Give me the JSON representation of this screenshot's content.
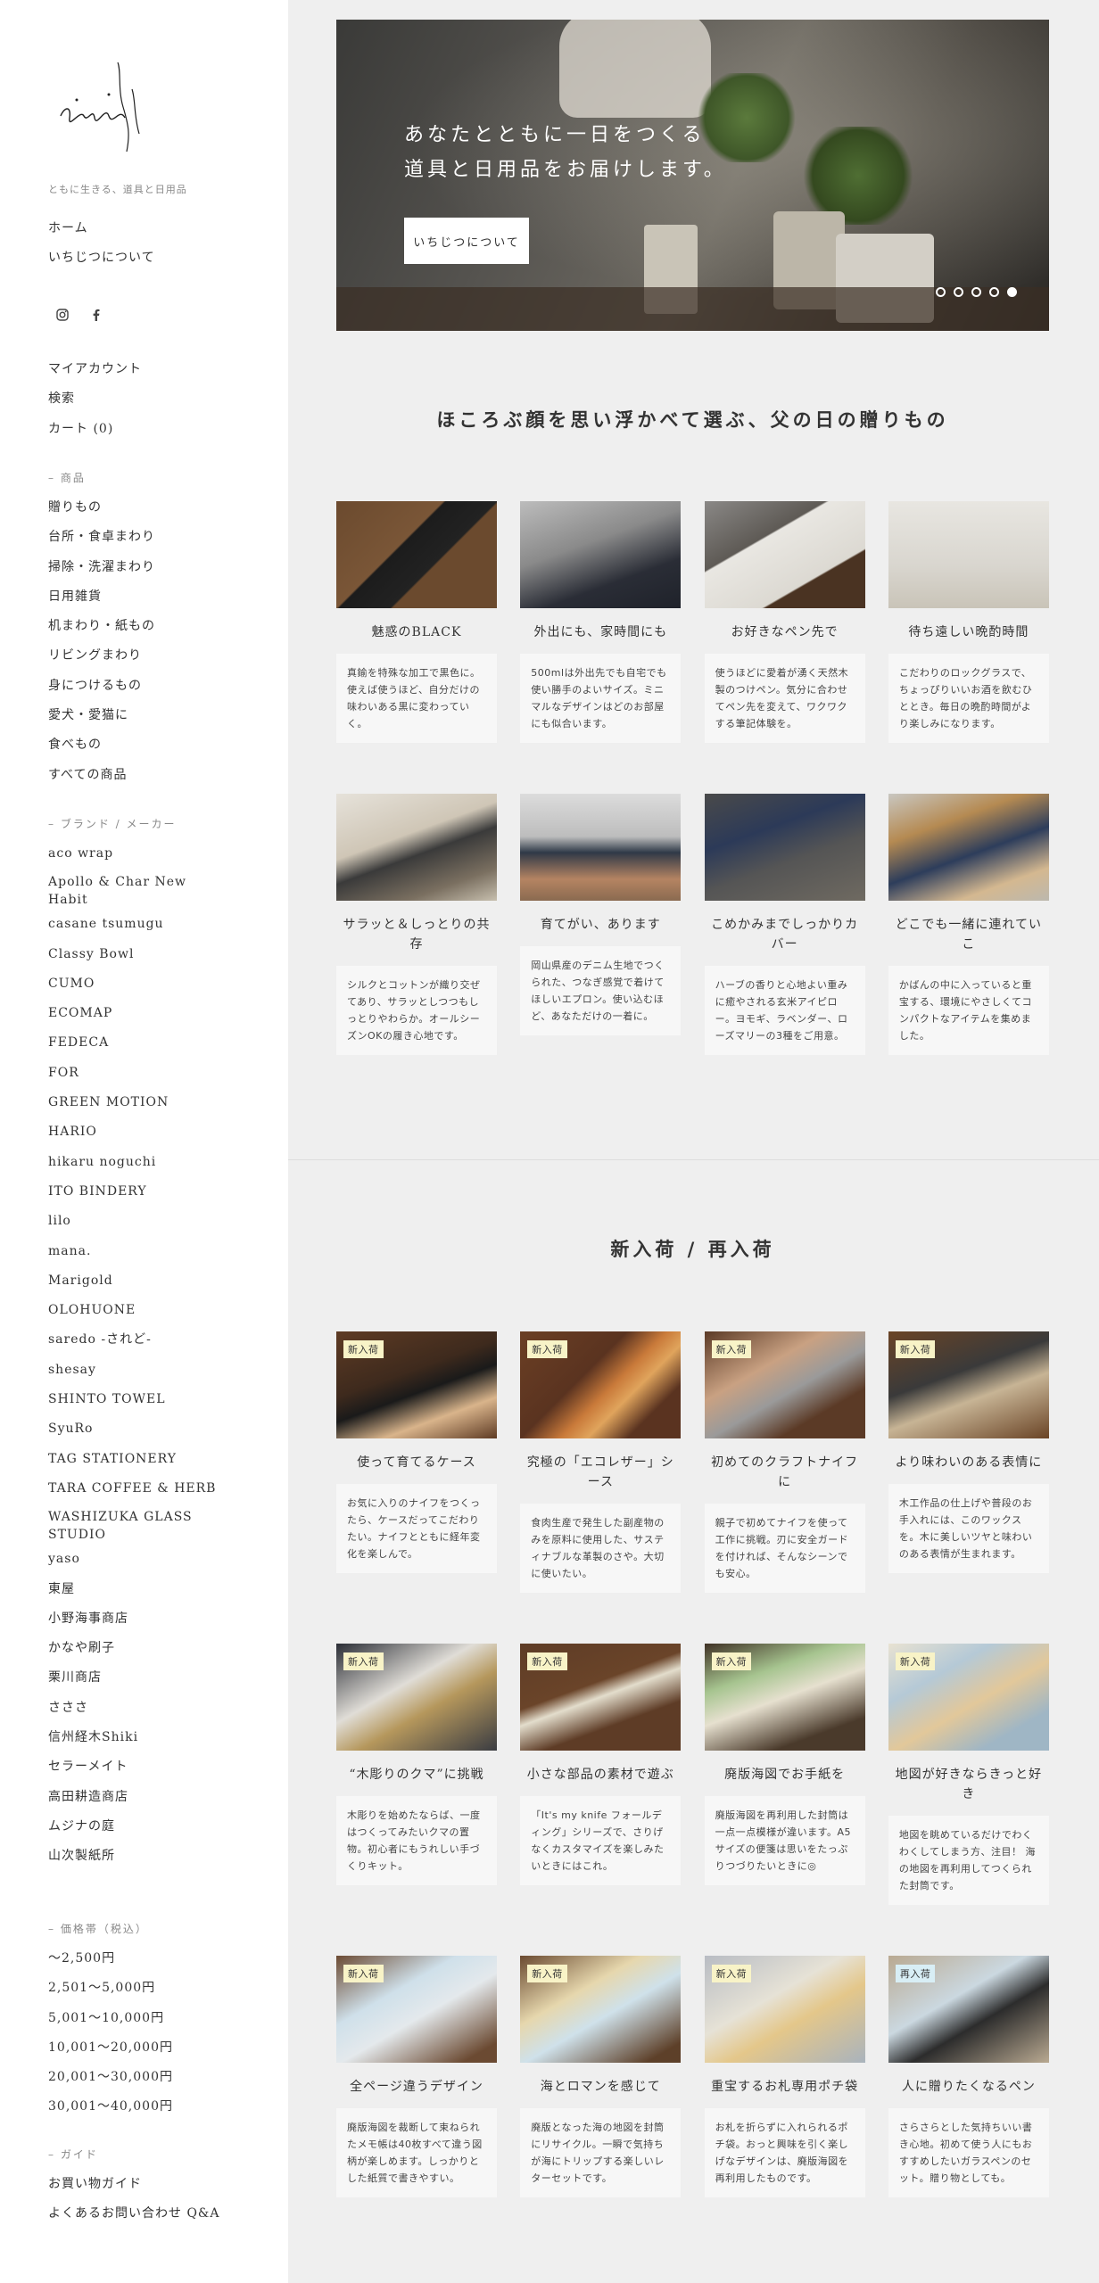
{
  "sidebar": {
    "tagline": "ともに生きる、道具と日用品",
    "primary_nav": [
      "ホーム",
      "いちじつについて"
    ],
    "account_nav": [
      "マイアカウント",
      "検索",
      "カート (0)"
    ],
    "products_head": "– 商品",
    "products": [
      "贈りもの",
      "台所・食卓まわり",
      "掃除・洗濯まわり",
      "日用雑貨",
      "机まわり・紙もの",
      "リビングまわり",
      "身につけるもの",
      "愛犬・愛猫に",
      "食べもの",
      "すべての商品"
    ],
    "brands_head": "– ブランド / メーカー",
    "brands": [
      "aco wrap",
      "Apollo & Char New Habit",
      "casane tsumugu",
      "Classy Bowl",
      "CUMO",
      "ECOMAP",
      "FEDECA",
      "FOR",
      "GREEN MOTION",
      "HARIO",
      "hikaru noguchi",
      "ITO BINDERY",
      "lilo",
      "mana.",
      "Marigold",
      "OLOHUONE",
      "saredo -されど-",
      "shesay",
      "SHINTO TOWEL",
      "SyuRo",
      "TAG STATIONERY",
      "TARA COFFEE & HERB",
      "WASHIZUKA GLASS STUDIO",
      "yaso",
      "東屋",
      "小野海事商店",
      "かなや刷子",
      "栗川商店",
      "さささ",
      "信州経木Shiki",
      "セラーメイト",
      "高田耕造商店",
      "ムジナの庭",
      "山次製紙所"
    ],
    "price_head": "– 価格帯（税込）",
    "prices": [
      "〜2,500円",
      "2,501〜5,000円",
      "5,001〜10,000円",
      "10,001〜20,000円",
      "20,001〜30,000円",
      "30,001〜40,000円"
    ],
    "guide_head": "– ガイド",
    "guide": [
      "お買い物ガイド",
      "よくあるお問い合わせ Q&A"
    ]
  },
  "hero": {
    "line1": "あなたとともに一日をつくる",
    "line2": "道具と日用品をお届けします。",
    "button": "いちじつについて",
    "slide_count": 5,
    "active_slide": 5
  },
  "section1": {
    "title": "ほころぶ顔を思い浮かべて選ぶ、父の日の贈りもの",
    "cards": [
      {
        "title": "魅惑のBLACK",
        "desc": "真鍮を特殊な加工で黒色に。使えば使うほど、自分だけの味わいある黒に変わっていく。"
      },
      {
        "title": "外出にも、家時間にも",
        "desc": "500mlは外出先でも自宅でも使い勝手のよいサイズ。ミニマルなデザインはどのお部屋にも似合います。"
      },
      {
        "title": "お好きなペン先で",
        "desc": "使うほどに愛着が湧く天然木製のつけペン。気分に合わせてペン先を変えて、ワクワクする筆記体験を。"
      },
      {
        "title": "待ち遠しい晩酌時間",
        "desc": "こだわりのロックグラスで、ちょっぴりいいお酒を飲むひととき。毎日の晩酌時間がより楽しみになります。"
      },
      {
        "title": "サラッと＆しっとりの共存",
        "desc": "シルクとコットンが織り交ぜてあり、サラッとしつつもしっとりやわらか。オールシーズンOKの履き心地です。"
      },
      {
        "title": "育てがい、あります",
        "desc": "岡山県産のデニム生地でつくられた、つなぎ感覚で着けてほしいエプロン。使い込むほど、あなただけの一着に。"
      },
      {
        "title": "こめかみまでしっかりカバー",
        "desc": "ハーブの香りと心地よい重みに癒やされる玄米アイピロー。ヨモギ、ラベンダー、ローズマリーの3種をご用意。"
      },
      {
        "title": "どこでも一緒に連れていこ",
        "desc": "かばんの中に入っていると重宝する、環境にやさしくてコンパクトなアイテムを集めました。"
      }
    ]
  },
  "section2": {
    "title": "新入荷 / 再入荷",
    "cards": [
      {
        "badge": "新入荷",
        "title": "使って育てるケース",
        "desc": "お気に入りのナイフをつくったら、ケースだってこだわりたい。ナイフとともに経年変化を楽しんで。"
      },
      {
        "badge": "新入荷",
        "title": "究極の「エコレザー」シース",
        "desc": "食肉生産で発生した副産物のみを原料に使用した、サスティナブルな革製のさや。大切に使いたい。"
      },
      {
        "badge": "新入荷",
        "title": "初めてのクラフトナイフに",
        "desc": "親子で初めてナイフを使って工作に挑戦。刃に安全ガードを付ければ、そんなシーンでも安心。"
      },
      {
        "badge": "新入荷",
        "title": "より味わいのある表情に",
        "desc": "木工作品の仕上げや普段のお手入れには、このワックスを。木に美しいツヤと味わいのある表情が生まれます。"
      },
      {
        "badge": "新入荷",
        "title": "“木彫りのクマ”に挑戦",
        "desc": "木彫りを始めたならば、一度はつくってみたいクマの置物。初心者にもうれしい手づくりキット。"
      },
      {
        "badge": "新入荷",
        "title": "小さな部品の素材で遊ぶ",
        "desc": "「It's my knife フォールディング」シリーズで、さりげなくカスタマイズを楽しみたいときにはこれ。"
      },
      {
        "badge": "新入荷",
        "title": "廃版海図でお手紙を",
        "desc": "廃版海図を再利用した封筒は一点一点模様が違います。A5サイズの便箋は思いをたっぷりつづりたいときに◎"
      },
      {
        "badge": "新入荷",
        "title": "地図が好きならきっと好き",
        "desc": "地図を眺めているだけでわくわくしてしまう方、注目！ 海の地図を再利用してつくられた封筒です。"
      },
      {
        "badge": "新入荷",
        "title": "全ページ違うデザイン",
        "desc": "廃版海図を裁断して束ねられたメモ帳は40枚すべて違う図柄が楽しめます。しっかりとした紙質で書きやすい。"
      },
      {
        "badge": "新入荷",
        "title": "海とロマンを感じて",
        "desc": "廃版となった海の地図を封筒にリサイクル。一瞬で気持ちが海にトリップする楽しいレターセットです。"
      },
      {
        "badge": "新入荷",
        "title": "重宝するお札専用ポチ袋",
        "desc": "お札を折らずに入れられるポチ袋。おっと興味を引く楽しげなデザインは、廃版海図を再利用したものです。"
      },
      {
        "badge": "再入荷",
        "title": "人に贈りたくなるペン",
        "desc": "さらさらとした気持ちいい書き心地。初めて使う人にもおすすめしたいガラスペンのセット。贈り物としても。"
      }
    ]
  },
  "colors": {
    "sidebar_bg": "#ffffff",
    "page_bg": "#efefef",
    "badge_new": "#f8f3c7",
    "badge_restock": "#d8eef5"
  }
}
